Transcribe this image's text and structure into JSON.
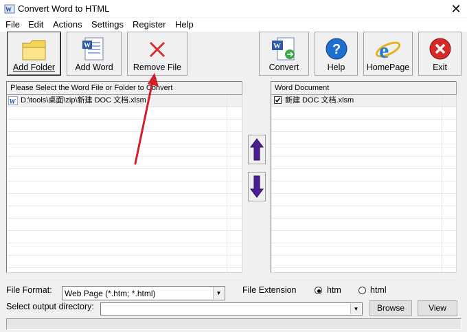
{
  "window": {
    "title": "Convert Word to HTML"
  },
  "menu": [
    "File",
    "Edit",
    "Actions",
    "Settings",
    "Register",
    "Help"
  ],
  "toolbar": {
    "add_folder": "Add Folder",
    "add_word": "Add Word",
    "remove_file": "Remove File",
    "convert": "Convert",
    "help": "Help",
    "homepage": "HomePage",
    "exit": "Exit"
  },
  "left_list": {
    "header": "Please Select the Word File or Folder to Convert",
    "rows": [
      {
        "text": "D:\\tools\\桌面\\zip\\新建 DOC 文档.xlsm"
      }
    ]
  },
  "right_list": {
    "header": "Word Document",
    "rows": [
      {
        "checked": true,
        "text": "新建 DOC 文档.xlsm"
      }
    ]
  },
  "options": {
    "file_format_label": "File Format:",
    "file_format_value": "Web Page (*.htm; *.html)",
    "file_extension_label": "File Extension",
    "ext_htm": "htm",
    "ext_html": "html",
    "selected_ext": "htm",
    "output_dir_label": "Select  output directory:",
    "output_dir_value": "",
    "browse": "Browse",
    "view": "View"
  },
  "colors": {
    "arrow_purple": "#4b1e96",
    "exit_red": "#d42a2a",
    "help_blue": "#1f6fd1",
    "annotation_red": "#d21f2a"
  }
}
